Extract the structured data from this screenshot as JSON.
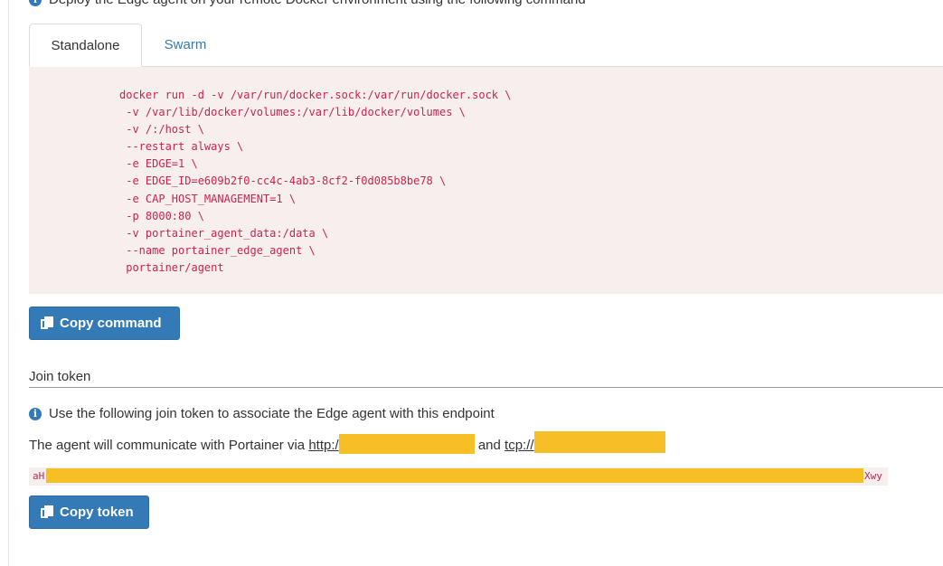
{
  "top_hint": "Deploy the Edge agent on your remote Docker environment using the following command",
  "tabs": [
    {
      "label": "Standalone",
      "active": true
    },
    {
      "label": "Swarm",
      "active": false
    }
  ],
  "command": {
    "lines": [
      "docker run -d -v /var/run/docker.sock:/var/run/docker.sock \\",
      " -v /var/lib/docker/volumes:/var/lib/docker/volumes \\",
      " -v /:/host \\",
      " --restart always \\",
      " -e EDGE=1 \\",
      " -e EDGE_ID=e609b2f0-cc4c-4ab3-8cf2-f0d085b8be78 \\",
      " -e CAP_HOST_MANAGEMENT=1 \\",
      " -p 8000:80 \\",
      " -v portainer_agent_data:/data \\",
      " --name portainer_edge_agent \\",
      " portainer/agent"
    ],
    "copy_label": "Copy command"
  },
  "join_token": {
    "section_title": "Join token",
    "hint": "Use the following join token to associate the Edge agent with this endpoint",
    "comm_prefix": "The agent will communicate with Portainer via",
    "http_link": "http:/",
    "and_text": "and",
    "tcp_link": "tcp://",
    "token_start": "aH",
    "token_end": "Xwy",
    "copy_label": "Copy token"
  },
  "colors": {
    "primary": "#337ab7",
    "code_text": "#c7254e",
    "code_bg": "#f7eeee",
    "redaction": "#f6bf26"
  },
  "icons": {
    "info": "info-circle-icon",
    "copy": "copy-icon"
  }
}
